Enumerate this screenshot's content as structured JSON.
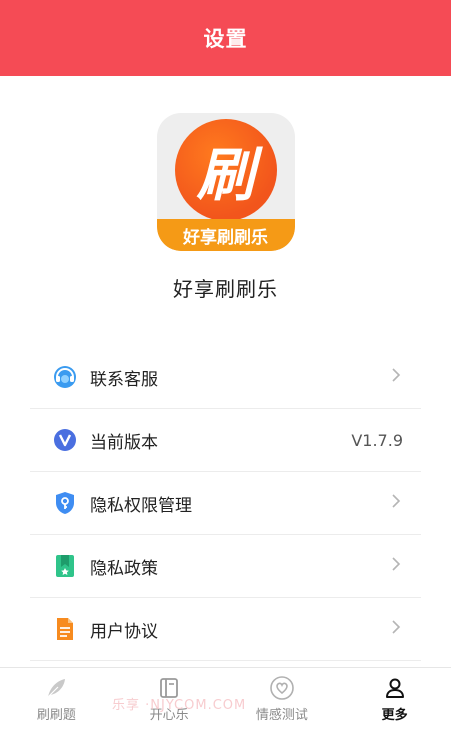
{
  "header": {
    "title": "设置"
  },
  "app": {
    "icon_glyph": "刷",
    "icon_banner": "好享刷刷乐",
    "name": "好享刷刷乐"
  },
  "menu": {
    "items": [
      {
        "label": "联系客服",
        "icon": "customer-service-icon",
        "right": "chevron-right-icon"
      },
      {
        "label": "当前版本",
        "icon": "version-icon",
        "value": "V1.7.9"
      },
      {
        "label": "隐私权限管理",
        "icon": "privacy-permission-icon",
        "right": "chevron-right-icon"
      },
      {
        "label": "隐私政策",
        "icon": "privacy-policy-icon",
        "right": "chevron-right-icon"
      },
      {
        "label": "用户协议",
        "icon": "user-agreement-icon",
        "right": "chevron-right-icon"
      }
    ]
  },
  "watermark": "乐享  ·NJYCOM.COM",
  "tabbar": {
    "tabs": [
      {
        "label": "刷刷题",
        "icon": "feather-icon",
        "active": false
      },
      {
        "label": "开心乐",
        "icon": "book-icon",
        "active": false
      },
      {
        "label": "情感测试",
        "icon": "heart-icon",
        "active": false
      },
      {
        "label": "更多",
        "icon": "user-icon",
        "active": true
      }
    ]
  },
  "colors": {
    "header": "#f54b55",
    "accent_orange": "#f2551c",
    "banner": "#f59a16"
  }
}
